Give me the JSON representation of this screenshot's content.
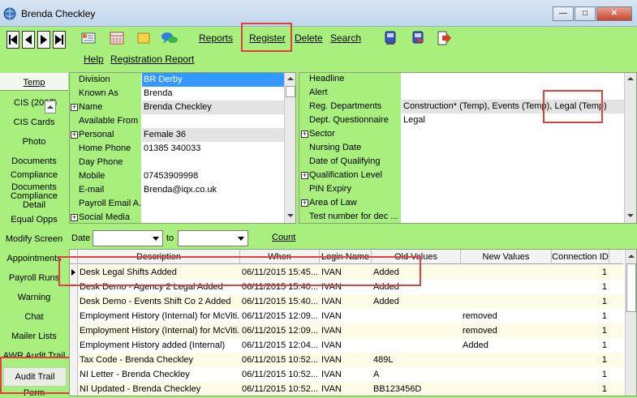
{
  "window": {
    "title": "Brenda Checkley"
  },
  "toolbar": {
    "links": [
      "Reports",
      "Register",
      "Delete",
      "Search"
    ],
    "links2": [
      "Help",
      "Registration Report"
    ]
  },
  "leftnav": [
    "Temp",
    "CIS (2007)",
    "CIS Cards",
    "Photo",
    "Documents",
    "Compliance",
    "Documents Compliance Detail",
    "Equal Opps",
    "Modify Screen",
    "Appointments",
    "Payroll Runs",
    "Warning",
    "Chat",
    "Mailer Lists",
    "AWR Audit Trail",
    "Audit Trail",
    "Perm"
  ],
  "details_left": [
    {
      "label": "Division",
      "value": "BR Derby",
      "plus": false,
      "highlight": true
    },
    {
      "label": "Known As",
      "value": "Brenda",
      "plus": false
    },
    {
      "label": "Name",
      "value": "Brenda Checkley",
      "plus": true,
      "grey": true
    },
    {
      "label": "Available From",
      "value": "",
      "plus": false
    },
    {
      "label": "Personal",
      "value": "Female 36",
      "plus": true,
      "grey": true
    },
    {
      "label": "Home Phone",
      "value": "01385 340033",
      "plus": false
    },
    {
      "label": "Day Phone",
      "value": "",
      "plus": false
    },
    {
      "label": "Mobile",
      "value": "07453909998",
      "plus": false
    },
    {
      "label": "E-mail",
      "value": "Brenda@iqx.co.uk",
      "plus": false
    },
    {
      "label": "Payroll Email A...",
      "value": "",
      "plus": false
    },
    {
      "label": "Social Media",
      "value": "",
      "plus": true
    }
  ],
  "details_right": [
    {
      "label": "Headline",
      "value": "",
      "plus": false
    },
    {
      "label": "Alert",
      "value": "",
      "plus": false
    },
    {
      "label": "Reg. Departments",
      "value": "Construction* (Temp), Events (Temp), Legal (Temp)",
      "plus": false,
      "grey": true
    },
    {
      "label": "Dept. Questionnaire",
      "value": "Legal",
      "plus": false
    },
    {
      "label": "Sector",
      "value": "",
      "plus": true
    },
    {
      "label": "Nursing Date",
      "value": "",
      "plus": false
    },
    {
      "label": "Date of Qualifying",
      "value": "",
      "plus": false
    },
    {
      "label": "Qualification Level",
      "value": "",
      "plus": true
    },
    {
      "label": "PIN Expiry",
      "value": "",
      "plus": false
    },
    {
      "label": "Area of Law",
      "value": "",
      "plus": true
    },
    {
      "label": "Test number for dec ...",
      "value": "",
      "plus": false
    }
  ],
  "filter": {
    "date_label": "Date",
    "to_label": "to",
    "count_label": "Count"
  },
  "audit": {
    "columns": [
      "Description",
      "When",
      "Login Name",
      "Old Values",
      "New Values",
      "Connection ID"
    ],
    "rows": [
      [
        "Desk Legal Shifts Added",
        "06/11/2015 15:45...",
        "IVAN",
        "Added",
        "",
        "1"
      ],
      [
        "Desk Demo - Agency 2 Legal Added",
        "06/11/2015 15:40...",
        "IVAN",
        "Added",
        "",
        "1"
      ],
      [
        "Desk Demo - Events Shift Co 2 Added",
        "06/11/2015 15:40...",
        "IVAN",
        "Added",
        "",
        "1"
      ],
      [
        "Employment History (Internal) for McViti...",
        "06/11/2015 12:09...",
        "IVAN",
        "",
        "removed",
        "1"
      ],
      [
        "Employment History (Internal) for McViti...",
        "06/11/2015 12:09...",
        "IVAN",
        "",
        "removed",
        "1"
      ],
      [
        "Employment History added (Internal)",
        "06/11/2015 12:04...",
        "IVAN",
        "",
        "Added",
        "1"
      ],
      [
        "Tax Code - Brenda Checkley",
        "06/11/2015 10:52...",
        "IVAN",
        "489L",
        "",
        "1"
      ],
      [
        "NI Letter - Brenda Checkley",
        "06/11/2015 10:52...",
        "IVAN",
        "A",
        "",
        "1"
      ],
      [
        "NI Updated - Brenda Checkley",
        "06/11/2015 10:52...",
        "IVAN",
        "BB123456D",
        "",
        "1"
      ]
    ]
  },
  "colors": {
    "background": "#a8ef7e",
    "highlight": "#3399ff",
    "annotation": "#e0413c"
  }
}
